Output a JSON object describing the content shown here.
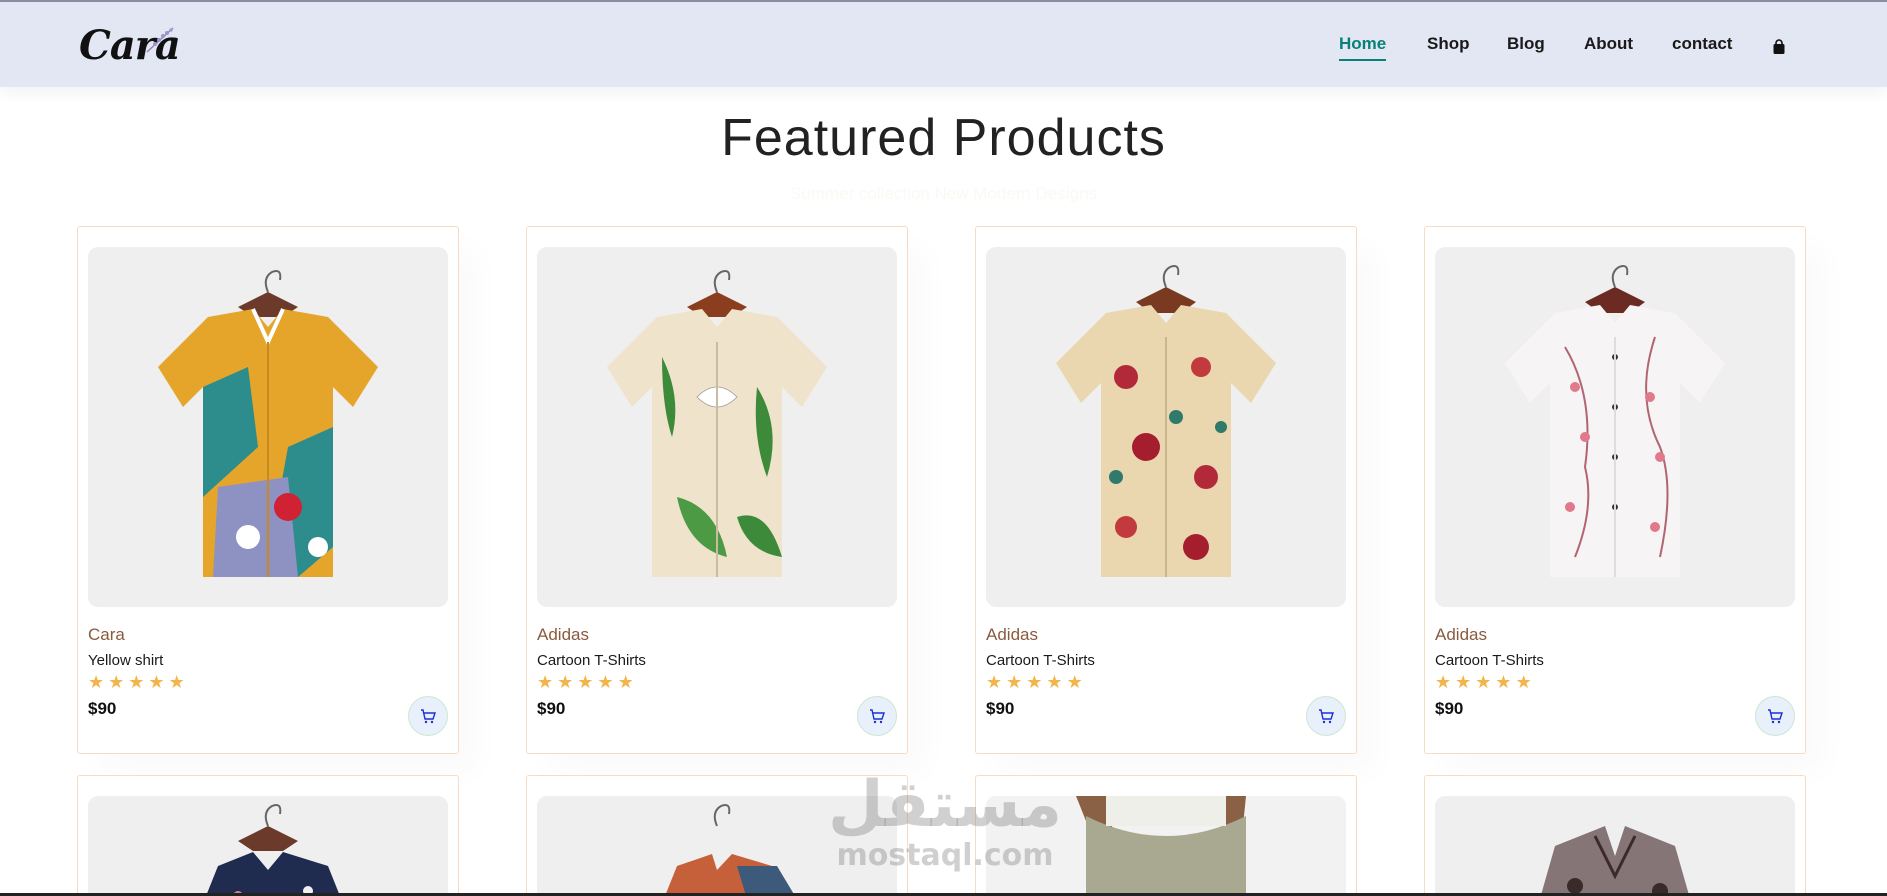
{
  "header": {
    "logo": "Cara",
    "nav": [
      {
        "label": "Home",
        "active": true
      },
      {
        "label": "Shop",
        "active": false
      },
      {
        "label": "Blog",
        "active": false
      },
      {
        "label": "About",
        "active": false
      },
      {
        "label": "contact",
        "active": false
      }
    ],
    "cart_icon": "bag-icon"
  },
  "section": {
    "title": "Featured Products",
    "subtitle": "Summer collection New Modern Designs"
  },
  "products": [
    {
      "brand": "Cara",
      "name": "Yellow shirt",
      "rating": 5,
      "price": "$90",
      "image": "colorful-shirt"
    },
    {
      "brand": "Adidas",
      "name": "Cartoon T-Shirts",
      "rating": 5,
      "price": "$90",
      "image": "leaf-shirt"
    },
    {
      "brand": "Adidas",
      "name": "Cartoon T-Shirts",
      "rating": 5,
      "price": "$90",
      "image": "floral-shirt"
    },
    {
      "brand": "Adidas",
      "name": "Cartoon T-Shirts",
      "rating": 5,
      "price": "$90",
      "image": "blossom-shirt"
    }
  ],
  "watermark": {
    "arabic": "مستقل",
    "latin": "mostaql.com"
  },
  "colors": {
    "accent": "#088178",
    "header_bg": "#e3e6f3",
    "brand_text": "#8a5a3e",
    "star": "#f3b54a"
  }
}
